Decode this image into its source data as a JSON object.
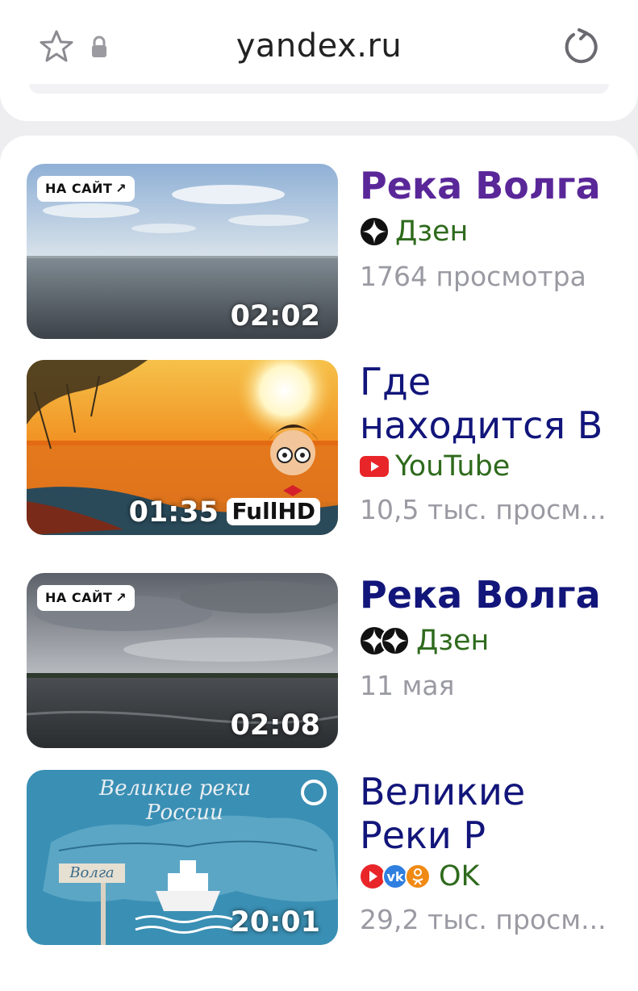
{
  "browser": {
    "url": "yandex.ru"
  },
  "videos": [
    {
      "title": "Река Волга",
      "source": "Дзен",
      "meta": "1764 просмотра",
      "duration": "02:02",
      "badge": "НА САЙТ",
      "visited": true
    },
    {
      "title": "Где находится В",
      "source": "YouTube",
      "meta": "10,5 тыс. просм...",
      "duration": "01:35",
      "quality": "FullHD"
    },
    {
      "title": "Река Волга",
      "source": "Дзен",
      "meta": "11 мая",
      "duration": "02:08",
      "badge": "НА САЙТ"
    },
    {
      "title": "Великие Реки Р",
      "source": "OK",
      "meta": "29,2 тыс. просм...",
      "duration": "20:01",
      "thumb_text_1": "Великие реки",
      "thumb_text_2": "России",
      "thumb_sign": "Волга"
    }
  ],
  "colors": {
    "title": "#12157a",
    "title_visited": "#5a2799",
    "source": "#2e6a1c",
    "meta": "#9a9aa3"
  }
}
